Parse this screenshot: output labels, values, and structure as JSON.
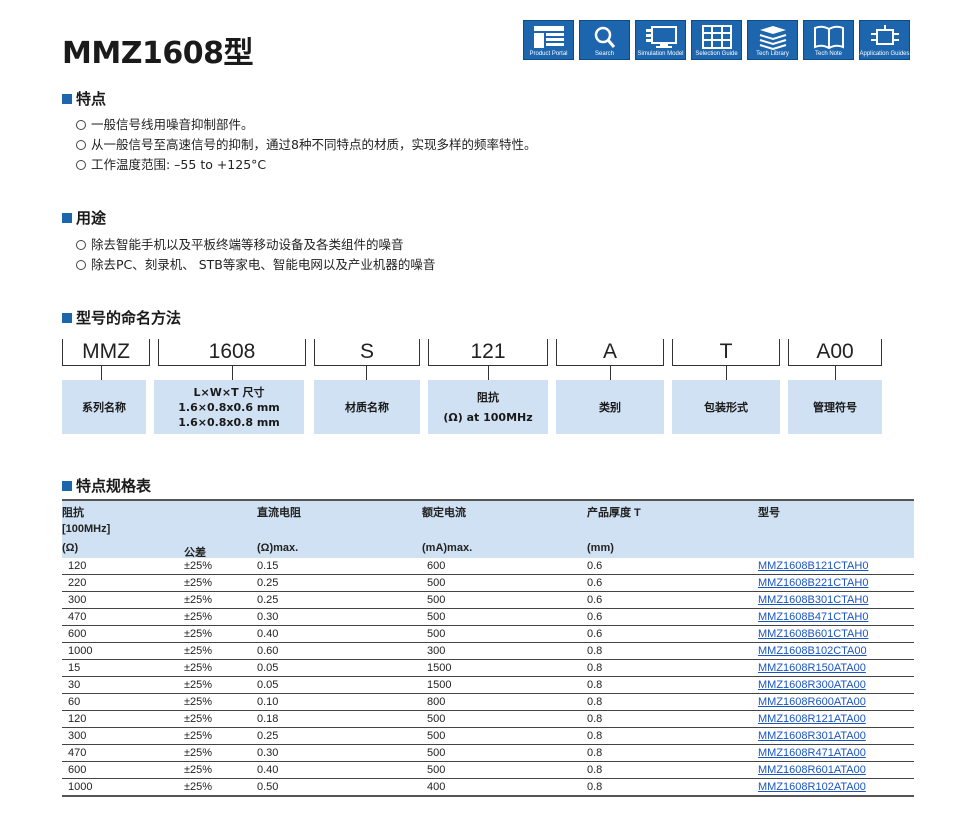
{
  "title": "MMZ1608型",
  "nav": [
    {
      "label": "Product Portal",
      "icon": "product-portal-icon"
    },
    {
      "label": "Search",
      "icon": "search-icon"
    },
    {
      "label": "Simulation Model",
      "icon": "simulation-model-icon"
    },
    {
      "label": "Selection Guide",
      "icon": "selection-guide-icon"
    },
    {
      "label": "Tech Library",
      "icon": "tech-library-icon"
    },
    {
      "label": "Tech Note",
      "icon": "tech-note-icon"
    },
    {
      "label": "Application Guides",
      "icon": "application-guides-icon"
    }
  ],
  "features": {
    "heading": "特点",
    "items": [
      "一般信号线用噪音抑制部件。",
      "从一般信号至高速信号的抑制，通过8种不同特点的材质，实现多样的频率特性。",
      "工作温度范围: –55 to +125°C"
    ]
  },
  "uses": {
    "heading": "用途",
    "items": [
      "除去智能手机以及平板终端等移动设备及各类组件的噪音",
      "除去PC、刻录机、 STB等家电、智能电网以及产业机器的噪音"
    ]
  },
  "naming": {
    "heading": "型号的命名方法",
    "codes": [
      "MMZ",
      "1608",
      "S",
      "121",
      "A",
      "T",
      "A00"
    ],
    "labels": [
      [
        "系列名称"
      ],
      [
        "L×W×T 尺寸",
        "1.6×0.8x0.6 mm",
        "1.6×0.8x0.8 mm"
      ],
      [
        "材质名称"
      ],
      [
        "阻抗",
        "(Ω) at 100MHz"
      ],
      [
        "类别"
      ],
      [
        "包装形式"
      ],
      [
        "管理符号"
      ]
    ]
  },
  "spec": {
    "heading": "特点规格表",
    "headers": {
      "impedance": [
        "阻抗",
        "[100MHz]",
        "(Ω)"
      ],
      "tolerance": "公差",
      "dc_resistance": [
        "直流电阻",
        "(Ω)max."
      ],
      "rated_current": [
        "额定电流",
        "(mA)max."
      ],
      "thickness": [
        "产品厚度 T",
        "(mm)"
      ],
      "part_number": "型号"
    },
    "rows": [
      [
        "120",
        "±25%",
        "0.15",
        "600",
        "0.6",
        "MMZ1608B121CTAH0"
      ],
      [
        "220",
        "±25%",
        "0.25",
        "500",
        "0.6",
        "MMZ1608B221CTAH0"
      ],
      [
        "300",
        "±25%",
        "0.25",
        "500",
        "0.6",
        "MMZ1608B301CTAH0"
      ],
      [
        "470",
        "±25%",
        "0.30",
        "500",
        "0.6",
        "MMZ1608B471CTAH0"
      ],
      [
        "600",
        "±25%",
        "0.40",
        "500",
        "0.6",
        "MMZ1608B601CTAH0"
      ],
      [
        "1000",
        "±25%",
        "0.60",
        "300",
        "0.8",
        "MMZ1608B102CTA00"
      ],
      [
        "15",
        "±25%",
        "0.05",
        "1500",
        "0.8",
        "MMZ1608R150ATA00"
      ],
      [
        "30",
        "±25%",
        "0.05",
        "1500",
        "0.8",
        "MMZ1608R300ATA00"
      ],
      [
        "60",
        "±25%",
        "0.10",
        "800",
        "0.8",
        "MMZ1608R600ATA00"
      ],
      [
        "120",
        "±25%",
        "0.18",
        "500",
        "0.8",
        "MMZ1608R121ATA00"
      ],
      [
        "300",
        "±25%",
        "0.25",
        "500",
        "0.8",
        "MMZ1608R301ATA00"
      ],
      [
        "470",
        "±25%",
        "0.30",
        "500",
        "0.8",
        "MMZ1608R471ATA00"
      ],
      [
        "600",
        "±25%",
        "0.40",
        "500",
        "0.8",
        "MMZ1608R601ATA00"
      ],
      [
        "1000",
        "±25%",
        "0.50",
        "400",
        "0.8",
        "MMZ1608R102ATA00"
      ]
    ]
  },
  "colors": {
    "accent": "#1d66ad",
    "header_bg": "#cfe1f2",
    "link": "#1a55c4"
  }
}
